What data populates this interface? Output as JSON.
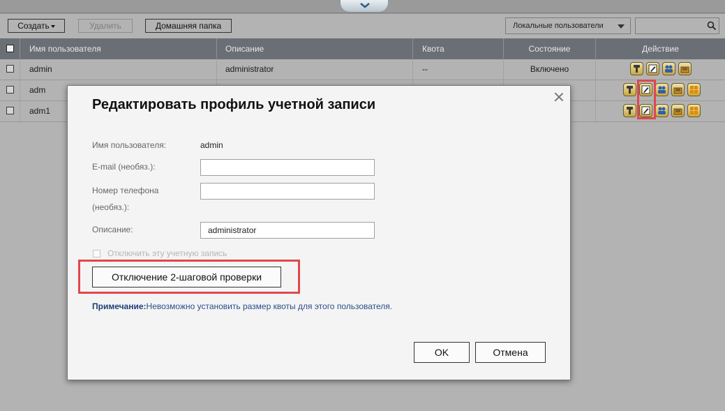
{
  "toolbar": {
    "create_label": "Создать",
    "delete_label": "Удалить",
    "home_folder_label": "Домашняя папка",
    "user_scope_value": "Локальные пользователи"
  },
  "table": {
    "headers": {
      "username": "Имя пользователя",
      "description": "Описание",
      "quota": "Квота",
      "status": "Состояние",
      "action": "Действие"
    },
    "rows": [
      {
        "username": "admin",
        "description": "administrator",
        "quota": "--",
        "status": "Включено"
      },
      {
        "username": "adm",
        "description": "",
        "quota": "",
        "status": ""
      },
      {
        "username": "adm1",
        "description": "",
        "quota": "",
        "status": ""
      }
    ]
  },
  "dialog": {
    "title": "Редактировать профиль учетной записи",
    "username_label": "Имя пользователя:",
    "username_value": "admin",
    "email_label": "E-mail (необяз.):",
    "email_value": "",
    "phone_label_line1": "Номер телефона",
    "phone_label_line2": "(необяз.):",
    "phone_value": "",
    "description_label": "Описание:",
    "description_value": "administrator",
    "disable_account_label": "Отключить эту учетную запись",
    "disable_2step_button": "Отключение 2-шаговой проверки",
    "note_prefix": "Примечание:",
    "note_text": "Невозможно установить размер квоты для этого пользователя.",
    "ok_label": "OK",
    "cancel_label": "Отмена"
  },
  "colors": {
    "highlight": "#e0474c",
    "header_bg": "#6a6f76",
    "overlay_bg": "#b3b3b3",
    "note_text": "#2a4e8a"
  },
  "icons": [
    "chevron-down-icon",
    "search-icon",
    "password-icon",
    "edit-profile-icon",
    "user-group-icon",
    "shared-folder-permission-icon",
    "application-privilege-icon",
    "close-icon"
  ]
}
